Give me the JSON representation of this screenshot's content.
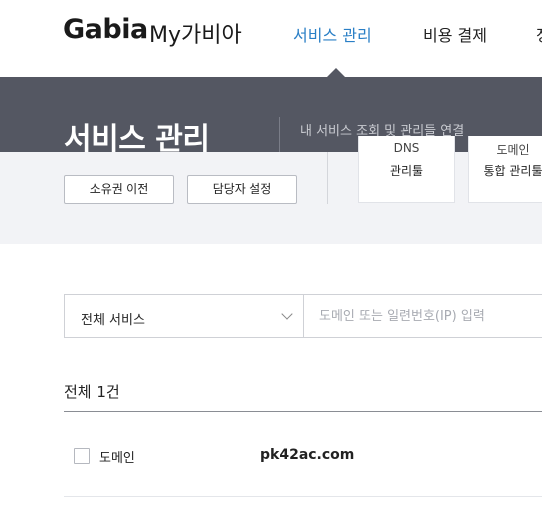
{
  "header": {
    "logo": "Gabia",
    "logo_sub": "My가비아",
    "nav": [
      {
        "label": "서비스 관리",
        "active": true
      },
      {
        "label": "비용 결제",
        "active": false
      },
      {
        "label": "정",
        "active": false
      }
    ]
  },
  "hero": {
    "title": "서비스 관리",
    "description": "내 서비스 조회 및 관리들 연결"
  },
  "actions": {
    "transfer_ownership": "소유권 이전",
    "manager_settings": "담당자 설정"
  },
  "tool_cards": [
    {
      "line1": "DNS",
      "line2": "관리툴"
    },
    {
      "line1": "도메인",
      "line2": "통합 관리툴"
    }
  ],
  "search": {
    "service_select": "전체 서비스",
    "placeholder": "도메인 또는 일련번호(IP) 입력"
  },
  "list": {
    "count_label": "전체 1건",
    "rows": [
      {
        "type": "도메인",
        "name": "pk42ac.com"
      }
    ]
  },
  "colors": {
    "accent": "#2a7fc6",
    "header_band": "#545762",
    "panel_bg": "#f2f3f6"
  }
}
